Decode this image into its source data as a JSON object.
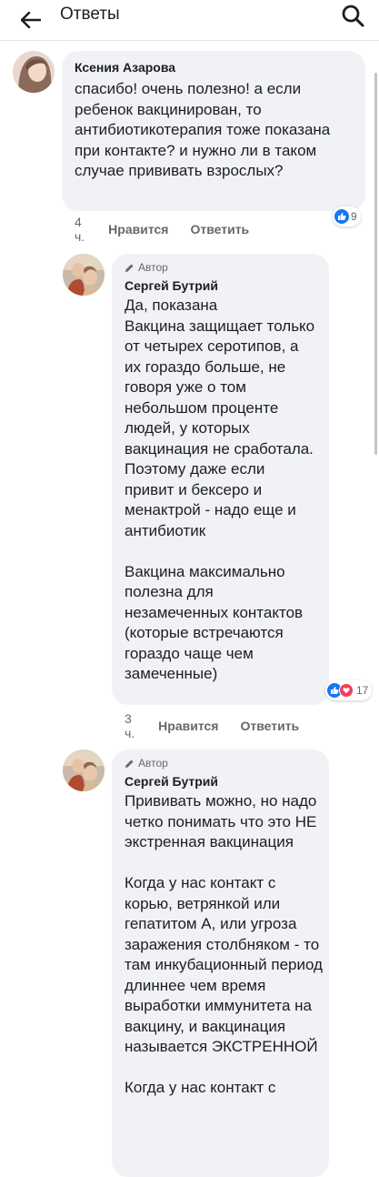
{
  "header": {
    "title": "Ответы"
  },
  "comments": [
    {
      "name": "Ксения Азарова",
      "text": "спасибо! очень полезно! а если ребенок вакцинирован, то антибиотикотерапия тоже показана при контакте? и нужно ли в таком случае прививать взрослых?",
      "time": "4 ч.",
      "like_label": "Нравится",
      "reply_label": "Ответить",
      "reaction_count": "9"
    },
    {
      "author_badge": "Автор",
      "name": "Сергей Бутрий",
      "text": "Да, показана\nВакцина защищает только от четырех серотипов, а их гораздо больше, не говоря уже о том небольшом проценте людей, у которых вакцинация не сработала. Поэтому даже если привит и бексеро и менактрой - надо еще и антибиотик\n\nВакцина максимально полезна для незамеченных контактов (которые встречаются гораздо чаще чем замеченные)",
      "time": "3 ч.",
      "like_label": "Нравится",
      "reply_label": "Ответить",
      "reaction_count": "17"
    },
    {
      "author_badge": "Автор",
      "name": "Сергей Бутрий",
      "text": "Прививать можно, но надо четко понимать что это НЕ экстренная вакцинация\n\nКогда у нас контакт с корью, ветрянкой или гепатитом А, или угроза заражения столбняком - то там инкубационный период длиннее чем время выработки иммунитета на вакцину, и вакцинация называется ЭКСТРЕННОЙ\n\nКогда у нас контакт с"
    }
  ],
  "colors": {
    "bubble": "#f0f2f5",
    "like_blue": "#1877f2",
    "heart_red": "#f33e58",
    "meta_gray": "#65676b"
  },
  "icons": [
    "back-arrow-icon",
    "search-icon",
    "pencil-icon",
    "like-icon",
    "heart-icon"
  ]
}
